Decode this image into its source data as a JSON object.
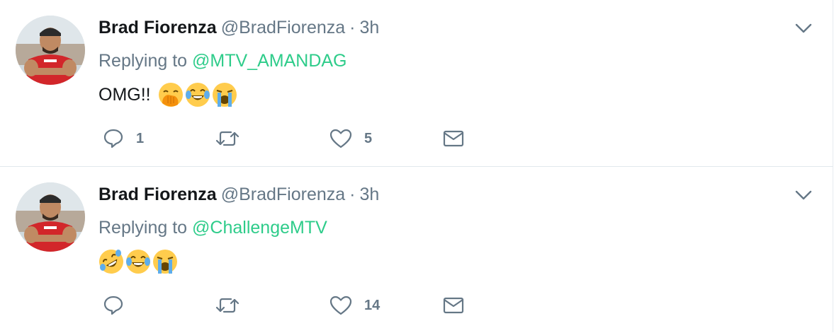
{
  "colors": {
    "mention": "#2ecc8a",
    "name": "#14171a",
    "muted": "#657786",
    "divider": "#e1e8ed"
  },
  "tweets": [
    {
      "name": "Brad Fiorenza",
      "handle": "@BradFiorenza",
      "separator": "·",
      "time": "3h",
      "replying_label": "Replying to",
      "replying_to": "@MTV_AMANDAG",
      "text": "OMG!!",
      "emojis": [
        "hand-over-mouth-emoji",
        "tears-of-joy-emoji",
        "loudly-crying-emoji"
      ],
      "reply_count": "1",
      "retweet_count": "",
      "like_count": "5"
    },
    {
      "name": "Brad Fiorenza",
      "handle": "@BradFiorenza",
      "separator": "·",
      "time": "3h",
      "replying_label": "Replying to",
      "replying_to": "@ChallengeMTV",
      "text": "",
      "emojis": [
        "rolling-laughing-emoji",
        "tears-of-joy-emoji",
        "loudly-crying-emoji"
      ],
      "reply_count": "",
      "retweet_count": "",
      "like_count": "14"
    }
  ]
}
